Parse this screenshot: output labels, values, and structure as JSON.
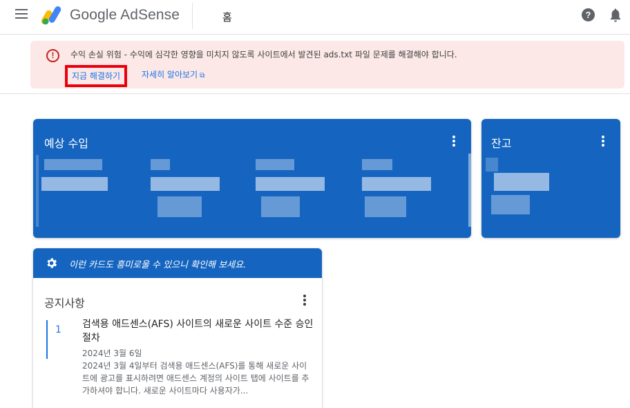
{
  "header": {
    "app_name": "Google AdSense",
    "page_title": "홈",
    "help_glyph": "?",
    "menu_icon": "hamburger-menu-icon",
    "bell_icon": "notification-bell-icon"
  },
  "alert": {
    "icon_glyph": "!",
    "message": "수익 손실 위험 - 수익에 심각한 영향을 미치지 않도록 사이트에서 발견된 ads.txt 파일 문제를 해결해야 합니다.",
    "fix_link": "지금 해결하기",
    "learn_link": "자세히 알아보기",
    "colors": {
      "background": "#fce8e6",
      "icon": "#c5221f",
      "link": "#1a73e8",
      "highlight_box": "#e8000d"
    }
  },
  "cards": {
    "earnings": {
      "title": "예상 수입"
    },
    "balance": {
      "title": "잔고"
    },
    "accent_color": "#1565c0"
  },
  "notice_card": {
    "banner_text": "이런 카드도 흥미로울 수 있으니 확인해 보세요.",
    "title": "공지사항",
    "items": [
      {
        "number": "1",
        "title": "검색용 애드센스(AFS) 사이트의 새로운 사이트 수준 승인 절차",
        "date": "2024년 3월 6일",
        "body": "2024년 3월 4일부터 검색용 애드센스(AFS)를 통해 새로운 사이트에 광고를 표시하려면 애드센스 계정의 사이트 탭에 사이트를 추가하셔야 합니다. 새로운 사이트마다 사용자가..."
      }
    ]
  }
}
